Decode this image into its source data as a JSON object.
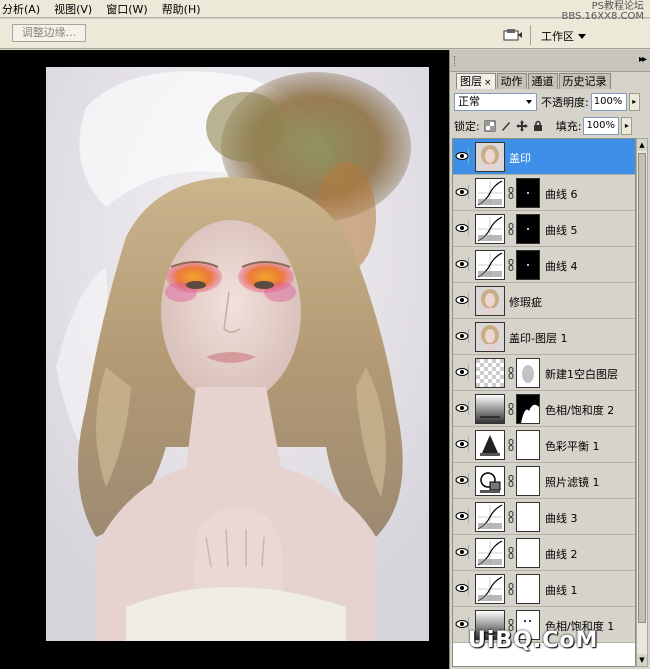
{
  "menubar": {
    "items": [
      "分析(A)",
      "视图(V)",
      "窗口(W)",
      "帮助(H)"
    ],
    "watermark_line1": "PS教程论坛",
    "watermark_line2": "BBS.16XX8.COM"
  },
  "options_bar": {
    "refine_edge_label": "调整边缘...",
    "workspace_label": "工作区"
  },
  "panel": {
    "tabs": [
      {
        "label": "图层",
        "close": "×"
      },
      {
        "label": "动作"
      },
      {
        "label": "通道"
      },
      {
        "label": "历史记录"
      }
    ],
    "blend_mode": "正常",
    "opacity_label": "不透明度:",
    "opacity_value": "100%",
    "lock_label": "锁定:",
    "fill_label": "填充:",
    "fill_value": "100%",
    "layers": [
      {
        "name": "盖印",
        "thumb": "photo",
        "mask": "none",
        "selected": true
      },
      {
        "name": "曲线 6",
        "thumb": "curves",
        "mask": "black-dot"
      },
      {
        "name": "曲线 5",
        "thumb": "curves",
        "mask": "black-dot"
      },
      {
        "name": "曲线 4",
        "thumb": "curves",
        "mask": "black-dot"
      },
      {
        "name": "修瑕疵",
        "thumb": "photo",
        "mask": "none"
      },
      {
        "name": "盖印-图层 1",
        "thumb": "photo",
        "mask": "none"
      },
      {
        "name": "新建1空白图层",
        "thumb": "checker",
        "mask": "gray-shape"
      },
      {
        "name": "色相/饱和度 2",
        "thumb": "gradient",
        "mask": "black-shape"
      },
      {
        "name": "色彩平衡 1",
        "thumb": "balance",
        "mask": "white"
      },
      {
        "name": "照片滤镜 1",
        "thumb": "filter",
        "mask": "white"
      },
      {
        "name": "曲线 3",
        "thumb": "curves",
        "mask": "white"
      },
      {
        "name": "曲线 2",
        "thumb": "curves",
        "mask": "white"
      },
      {
        "name": "曲线 1",
        "thumb": "curves",
        "mask": "white"
      },
      {
        "name": "色相/饱和度 1",
        "thumb": "gradient",
        "mask": "white-dots"
      }
    ]
  },
  "watermark_bottom": "UiBQ.CoM"
}
